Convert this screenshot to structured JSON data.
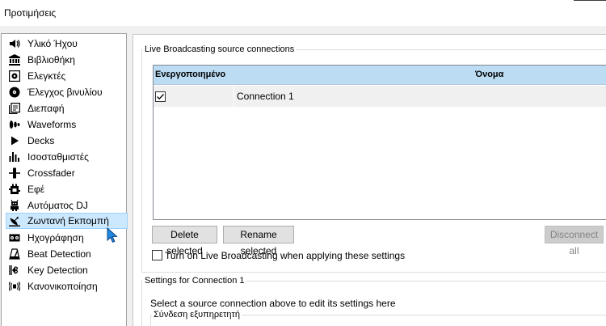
{
  "window": {
    "title": "Προτιμήσεις"
  },
  "sidebar": {
    "items": [
      {
        "label": "Υλικό Ήχου",
        "icon": "speaker-icon"
      },
      {
        "label": "Βιβλιοθήκη",
        "icon": "library-icon"
      },
      {
        "label": "Ελεγκτές",
        "icon": "controller-icon"
      },
      {
        "label": "Έλεγχος βινυλίου",
        "icon": "vinyl-icon"
      },
      {
        "label": "Διεπαφή",
        "icon": "interface-icon"
      },
      {
        "label": "Waveforms",
        "icon": "waveform-icon"
      },
      {
        "label": "Decks",
        "icon": "play-icon"
      },
      {
        "label": "Ισοσταθμιστές",
        "icon": "equalizer-icon"
      },
      {
        "label": "Crossfader",
        "icon": "crossfader-icon"
      },
      {
        "label": "Εφέ",
        "icon": "effects-icon"
      },
      {
        "label": "Αυτόματος DJ",
        "icon": "robot-icon"
      },
      {
        "label": "Ζωντανή Εκπομπή",
        "icon": "satellite-dish-icon",
        "selected": true
      },
      {
        "label": "Ηχογράφηση",
        "icon": "recording-icon"
      },
      {
        "label": "Beat Detection",
        "icon": "metronome-icon"
      },
      {
        "label": "Key Detection",
        "icon": "key-clef-icon"
      },
      {
        "label": "Κανονικοποίηση",
        "icon": "normalize-icon"
      }
    ]
  },
  "connections": {
    "group_title": "Live Broadcasting source connections",
    "columns": {
      "enabled": "Ενεργοποιημένο",
      "name": "Όνομα"
    },
    "rows": [
      {
        "enabled": true,
        "name": "Connection 1"
      }
    ],
    "buttons": {
      "delete": "Delete selected",
      "rename": "Rename selected",
      "disconnect": "Disconnect all"
    },
    "auto_enable": {
      "label": "Turn on Live Broadcasting when applying these settings",
      "checked": false
    }
  },
  "settings": {
    "group_title": "Settings for Connection 1",
    "hint": "Select a source connection above to edit its settings here",
    "server_group_title": "Σύνδεση εξυπηρετητή"
  },
  "colors": {
    "selection": "#cce8ff",
    "selection_border": "#99d1ff",
    "table_header": "#bcdcf4",
    "cursor": "#1e88e5"
  }
}
